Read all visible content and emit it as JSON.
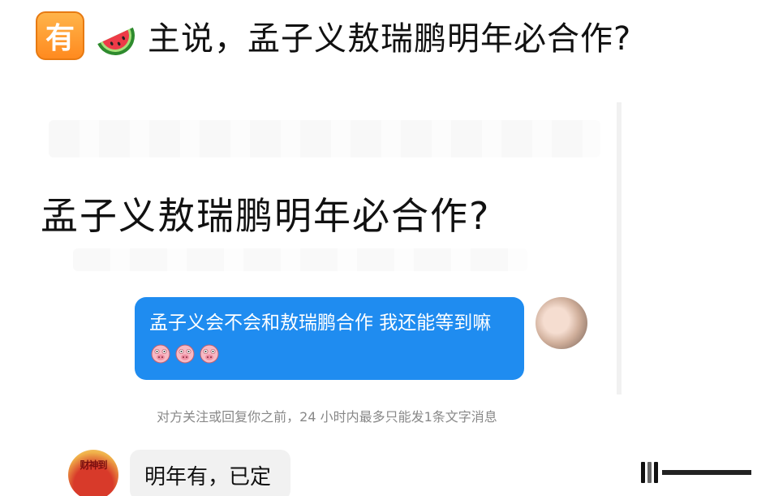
{
  "post": {
    "badge": "有",
    "title": "主说，孟子义敖瑞鹏明年必合作?"
  },
  "screenshot": {
    "headline": "孟子义敖瑞鹏明年必合作?",
    "sent_message": "孟子义会不会和敖瑞鹏合作 我还能等到嘛",
    "notice": "对方关注或回复你之前，24 小时内最多只能发1条文字消息",
    "reply_avatar_text": "财神到",
    "reply_message": "明年有，已定"
  },
  "icons": {
    "header_emoji": "watermelon-icon",
    "message_emojis": [
      "pig-face-icon",
      "pig-face-icon",
      "pig-face-icon"
    ]
  },
  "colors": {
    "bubble_blue": "#1f8cf0",
    "badge_orange": "#ff8a1f",
    "reply_bubble": "#f1f1f1"
  }
}
